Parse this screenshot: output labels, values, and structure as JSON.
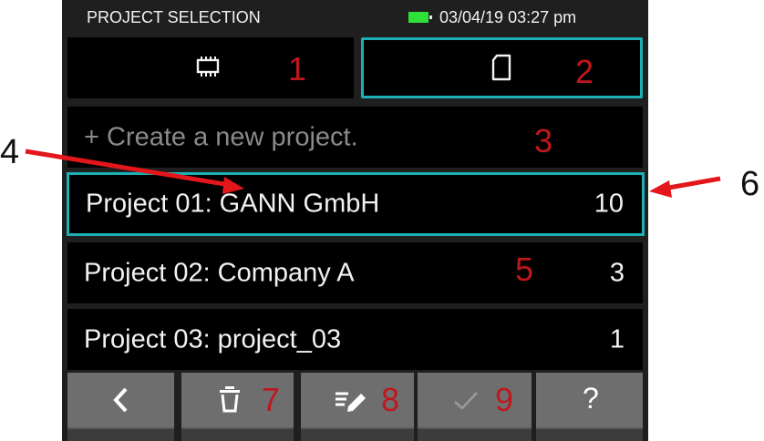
{
  "status_bar": {
    "title": "PROJECT SELECTION",
    "datetime": "03/04/19 03:27 pm"
  },
  "storage_tabs": [
    {
      "icon": "memory-chip-icon"
    },
    {
      "icon": "sd-card-icon"
    }
  ],
  "create_row": {
    "label": "+ Create a new project."
  },
  "projects": [
    {
      "label": "Project 01: GANN GmbH",
      "count": "10"
    },
    {
      "label": "Project 02: Company A",
      "count": "3"
    },
    {
      "label": "Project 03: project_03",
      "count": "1"
    }
  ],
  "toolbar": {
    "back_icon": "chevron-left-icon",
    "delete_icon": "trash-icon",
    "edit_icon": "edit-icon",
    "confirm_icon": "check-icon",
    "help_label": "?"
  },
  "annotations": {
    "n1": "1",
    "n2": "2",
    "n3": "3",
    "n4": "4",
    "n5": "5",
    "n6": "6",
    "n7": "7",
    "n8": "8",
    "n9": "9"
  },
  "colors": {
    "accent": "#1ab0b4",
    "battery": "#2fe03a",
    "annotation_red": "#c0171d",
    "arrow_red": "#e3161b"
  }
}
